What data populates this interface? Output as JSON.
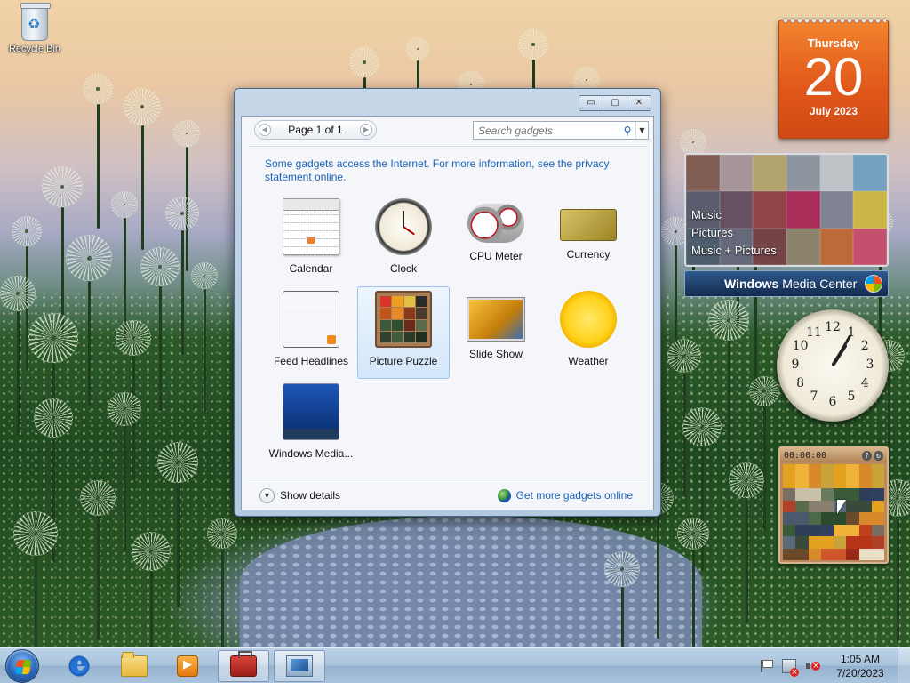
{
  "desktop": {
    "icons": [
      {
        "label": "Recycle Bin",
        "icon": "recycle-bin-icon"
      }
    ]
  },
  "gadgets": {
    "calendar": {
      "weekday": "Thursday",
      "day": "20",
      "month_year": "July 2023"
    },
    "media_center": {
      "menu": [
        "Music",
        "Pictures",
        "Music + Pictures"
      ],
      "brand_bold": "Windows",
      "brand_light": " Media Center"
    },
    "clock": {
      "numerals": [
        "12",
        "1",
        "2",
        "3",
        "4",
        "5",
        "6",
        "7",
        "8",
        "9",
        "10",
        "11"
      ],
      "hour": 1,
      "minute": 5
    },
    "picture_puzzle": {
      "timer": "00:00:00"
    }
  },
  "window": {
    "caption_buttons": {
      "minimize": "▭",
      "maximize": "▢",
      "close": "✕"
    },
    "pager": {
      "text": "Page 1 of 1",
      "prev": "◀",
      "next": "▶"
    },
    "search": {
      "placeholder": "Search gadgets",
      "dropdown": "▼"
    },
    "info_text": "Some gadgets access the Internet.  For more information, see the privacy statement online.",
    "gadgets": [
      {
        "name": "Calendar",
        "icon": "calendar-thumb-icon",
        "selected": false
      },
      {
        "name": "Clock",
        "icon": "clock-thumb-icon",
        "selected": false
      },
      {
        "name": "CPU Meter",
        "icon": "cpu-meter-thumb-icon",
        "selected": false
      },
      {
        "name": "Currency",
        "icon": "currency-thumb-icon",
        "selected": false
      },
      {
        "name": "Feed Headlines",
        "icon": "feed-headlines-thumb-icon",
        "selected": false
      },
      {
        "name": "Picture Puzzle",
        "icon": "picture-puzzle-thumb-icon",
        "selected": true
      },
      {
        "name": "Slide Show",
        "icon": "slide-show-thumb-icon",
        "selected": false
      },
      {
        "name": "Weather",
        "icon": "weather-thumb-icon",
        "selected": false
      },
      {
        "name": "Windows Media...",
        "icon": "windows-media-center-thumb-icon",
        "selected": false
      }
    ],
    "show_details": "Show details",
    "get_more": "Get more gadgets online"
  },
  "taskbar": {
    "pinned": [
      "internet-explorer-icon",
      "windows-explorer-icon",
      "windows-media-player-icon",
      "toolbox-icon",
      "display-settings-icon"
    ],
    "active": [
      "toolbox-icon",
      "display-settings-icon"
    ],
    "time": "1:05 AM",
    "date": "7/20/2023"
  },
  "colors": {
    "calendar_orange": "#e0561a",
    "link_blue": "#1a62b8",
    "selection_border": "#9cc4ee",
    "taskbar": "#a9c3dc"
  }
}
